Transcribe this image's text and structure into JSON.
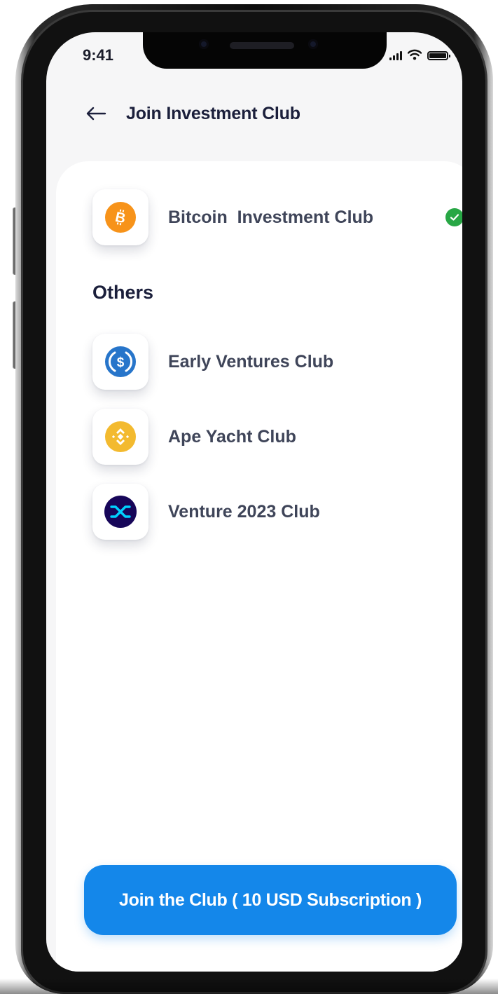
{
  "status_bar": {
    "time": "9:41"
  },
  "header": {
    "title": "Join Investment Club"
  },
  "selected_club": {
    "name": "Bitcoin  Investment Club",
    "selected": true,
    "icon": "bitcoin-icon",
    "color": "#f7931a"
  },
  "others": {
    "title": "Others",
    "items": [
      {
        "name": "Early Ventures Club",
        "icon": "usdc-icon",
        "color": "#2775ca"
      },
      {
        "name": "Ape Yacht Club",
        "icon": "binance-icon",
        "color": "#f3ba2f"
      },
      {
        "name": "Venture 2023 Club",
        "icon": "synthetix-icon",
        "color": "#170659"
      }
    ]
  },
  "join_button": {
    "label": "Join the Club ( 10 USD Subscription )",
    "color": "#1487ea"
  }
}
